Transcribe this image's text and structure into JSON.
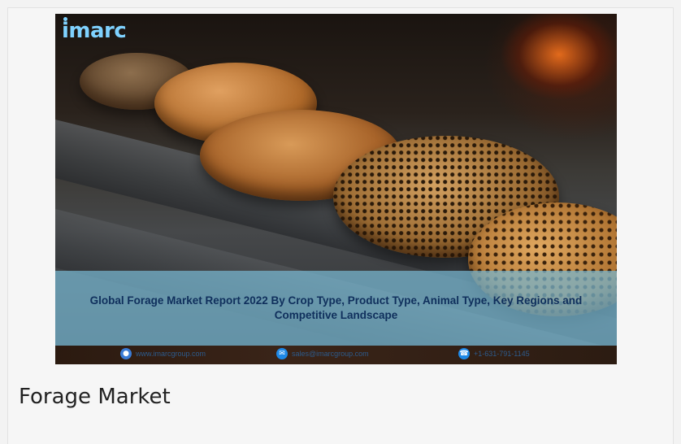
{
  "banner": {
    "logo_text": "imarc",
    "title": "Global Forage Market Report 2022 By Crop Type, Product Type, Animal Type, Key Regions and Competitive Landscape",
    "contacts": [
      {
        "icon": "globe-icon",
        "text": "www.imarcgroup.com",
        "color": "#3a7bd5"
      },
      {
        "icon": "email-icon",
        "text": "sales@imarcgroup.com",
        "color": "#1e88e5"
      },
      {
        "icon": "phone-icon",
        "text": "+1-631-791-1145",
        "color": "#1e88e5"
      }
    ]
  },
  "caption": "Forage Market",
  "colors": {
    "logo": "#7fd2ff",
    "title_text": "#0f2f5c",
    "band": "#78b9d2"
  }
}
